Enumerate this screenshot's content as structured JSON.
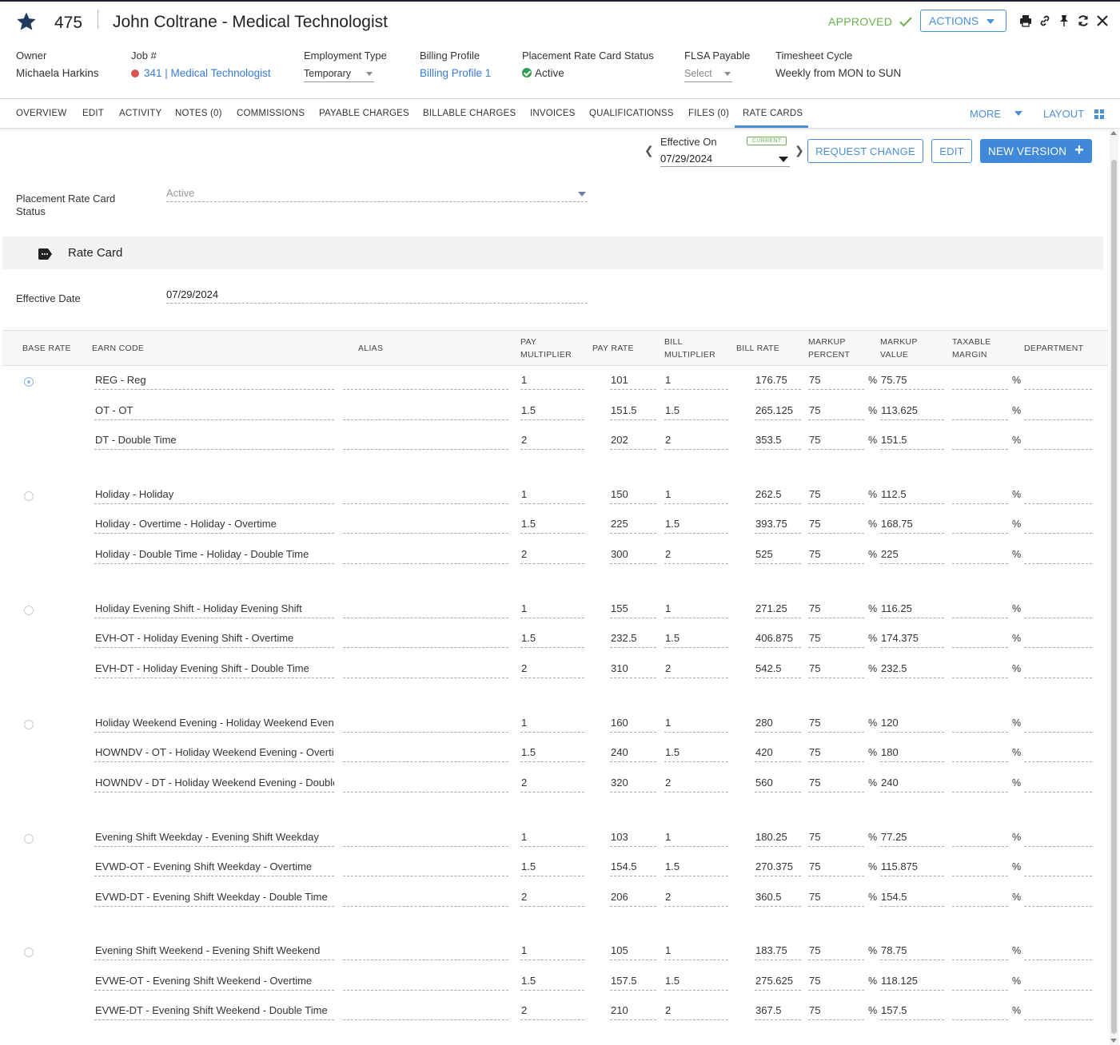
{
  "header": {
    "record_id": "475",
    "title": "John Coltrane - Medical Technologist",
    "status": "APPROVED",
    "actions_label": "ACTIONS",
    "fields": {
      "owner": {
        "label": "Owner",
        "value": "Michaela Harkins"
      },
      "job": {
        "label": "Job #",
        "value": "341 | Medical Technologist"
      },
      "employment_type": {
        "label": "Employment Type",
        "value": "Temporary"
      },
      "billing_profile": {
        "label": "Billing Profile",
        "value": "Billing Profile 1"
      },
      "rate_card_status": {
        "label": "Placement Rate Card Status",
        "value": "Active"
      },
      "flsa_payable": {
        "label": "FLSA Payable",
        "value": "Select"
      },
      "timesheet_cycle": {
        "label": "Timesheet Cycle",
        "value": "Weekly from MON to SUN"
      }
    }
  },
  "tabs": {
    "items": [
      "OVERVIEW",
      "EDIT",
      "ACTIVITY",
      "NOTES (0)",
      "COMMISSIONS",
      "PAYABLE CHARGES",
      "BILLABLE CHARGES",
      "INVOICES",
      "QUALIFICATIONSS",
      "FILES (0)",
      "RATE CARDS"
    ],
    "active": "RATE CARDS",
    "more_label": "MORE",
    "layout_label": "LAYOUT"
  },
  "toolbar": {
    "effective_on_label": "Effective On",
    "current_badge": "CURRENT",
    "effective_on_value": "07/29/2024",
    "request_change_label": "REQUEST CHANGE",
    "edit_label": "EDIT",
    "new_version_label": "NEW VERSION"
  },
  "form": {
    "status_label": "Placement Rate Card Status",
    "status_value": "Active",
    "section_title": "Rate Card",
    "effective_date_label": "Effective Date",
    "effective_date_value": "07/29/2024"
  },
  "table": {
    "headers": {
      "base_rate": "BASE RATE",
      "earn_code": "EARN CODE",
      "alias": "ALIAS",
      "pay_multiplier": "PAY MULTIPLIER",
      "pay_rate": "PAY RATE",
      "bill_multiplier": "BILL MULTIPLIER",
      "bill_rate": "BILL RATE",
      "markup_percent": "MARKUP PERCENT",
      "markup_value": "MARKUP VALUE",
      "taxable_margin": "TAXABLE MARGIN",
      "department": "DEPARTMENT"
    },
    "percent_symbol": "%",
    "groups": [
      {
        "base_rate_selected": true,
        "rows": [
          {
            "earn_code": "REG - Reg",
            "alias": "",
            "pay_multiplier": "1",
            "pay_rate": "101",
            "bill_multiplier": "1",
            "bill_rate": "176.75",
            "markup_percent": "75",
            "markup_value": "75.75",
            "taxable_margin": "",
            "department": ""
          },
          {
            "earn_code": "OT - OT",
            "alias": "",
            "pay_multiplier": "1.5",
            "pay_rate": "151.5",
            "bill_multiplier": "1.5",
            "bill_rate": "265.125",
            "markup_percent": "75",
            "markup_value": "113.625",
            "taxable_margin": "",
            "department": ""
          },
          {
            "earn_code": "DT - Double Time",
            "alias": "",
            "pay_multiplier": "2",
            "pay_rate": "202",
            "bill_multiplier": "2",
            "bill_rate": "353.5",
            "markup_percent": "75",
            "markup_value": "151.5",
            "taxable_margin": "",
            "department": ""
          }
        ]
      },
      {
        "base_rate_selected": false,
        "rows": [
          {
            "earn_code": "Holiday - Holiday",
            "alias": "",
            "pay_multiplier": "1",
            "pay_rate": "150",
            "bill_multiplier": "1",
            "bill_rate": "262.5",
            "markup_percent": "75",
            "markup_value": "112.5",
            "taxable_margin": "",
            "department": ""
          },
          {
            "earn_code": "Holiday - Overtime - Holiday - Overtime",
            "alias": "",
            "pay_multiplier": "1.5",
            "pay_rate": "225",
            "bill_multiplier": "1.5",
            "bill_rate": "393.75",
            "markup_percent": "75",
            "markup_value": "168.75",
            "taxable_margin": "",
            "department": ""
          },
          {
            "earn_code": "Holiday - Double Time - Holiday - Double Time",
            "alias": "",
            "pay_multiplier": "2",
            "pay_rate": "300",
            "bill_multiplier": "2",
            "bill_rate": "525",
            "markup_percent": "75",
            "markup_value": "225",
            "taxable_margin": "",
            "department": ""
          }
        ]
      },
      {
        "base_rate_selected": false,
        "rows": [
          {
            "earn_code": "Holiday Evening Shift - Holiday Evening Shift",
            "alias": "",
            "pay_multiplier": "1",
            "pay_rate": "155",
            "bill_multiplier": "1",
            "bill_rate": "271.25",
            "markup_percent": "75",
            "markup_value": "116.25",
            "taxable_margin": "",
            "department": ""
          },
          {
            "earn_code": "EVH-OT - Holiday Evening Shift - Overtime",
            "alias": "",
            "pay_multiplier": "1.5",
            "pay_rate": "232.5",
            "bill_multiplier": "1.5",
            "bill_rate": "406.875",
            "markup_percent": "75",
            "markup_value": "174.375",
            "taxable_margin": "",
            "department": ""
          },
          {
            "earn_code": "EVH-DT - Holiday Evening Shift - Double Time",
            "alias": "",
            "pay_multiplier": "2",
            "pay_rate": "310",
            "bill_multiplier": "2",
            "bill_rate": "542.5",
            "markup_percent": "75",
            "markup_value": "232.5",
            "taxable_margin": "",
            "department": ""
          }
        ]
      },
      {
        "base_rate_selected": false,
        "rows": [
          {
            "earn_code": "Holiday Weekend Evening  - Holiday Weekend Evening",
            "alias": "",
            "pay_multiplier": "1",
            "pay_rate": "160",
            "bill_multiplier": "1",
            "bill_rate": "280",
            "markup_percent": "75",
            "markup_value": "120",
            "taxable_margin": "",
            "department": ""
          },
          {
            "earn_code": "HOWNDV - OT - Holiday Weekend Evening - Overtime",
            "alias": "",
            "pay_multiplier": "1.5",
            "pay_rate": "240",
            "bill_multiplier": "1.5",
            "bill_rate": "420",
            "markup_percent": "75",
            "markup_value": "180",
            "taxable_margin": "",
            "department": ""
          },
          {
            "earn_code": "HOWNDV - DT - Holiday Weekend Evening - Double Time",
            "alias": "",
            "pay_multiplier": "2",
            "pay_rate": "320",
            "bill_multiplier": "2",
            "bill_rate": "560",
            "markup_percent": "75",
            "markup_value": "240",
            "taxable_margin": "",
            "department": ""
          }
        ]
      },
      {
        "base_rate_selected": false,
        "rows": [
          {
            "earn_code": "Evening Shift Weekday - Evening Shift Weekday",
            "alias": "",
            "pay_multiplier": "1",
            "pay_rate": "103",
            "bill_multiplier": "1",
            "bill_rate": "180.25",
            "markup_percent": "75",
            "markup_value": "77.25",
            "taxable_margin": "",
            "department": ""
          },
          {
            "earn_code": "EVWD-OT - Evening Shift Weekday - Overtime",
            "alias": "",
            "pay_multiplier": "1.5",
            "pay_rate": "154.5",
            "bill_multiplier": "1.5",
            "bill_rate": "270.375",
            "markup_percent": "75",
            "markup_value": "115.875",
            "taxable_margin": "",
            "department": ""
          },
          {
            "earn_code": "EVWD-DT - Evening Shift Weekday - Double Time",
            "alias": "",
            "pay_multiplier": "2",
            "pay_rate": "206",
            "bill_multiplier": "2",
            "bill_rate": "360.5",
            "markup_percent": "75",
            "markup_value": "154.5",
            "taxable_margin": "",
            "department": ""
          }
        ]
      },
      {
        "base_rate_selected": false,
        "rows": [
          {
            "earn_code": "Evening Shift Weekend - Evening Shift Weekend",
            "alias": "",
            "pay_multiplier": "1",
            "pay_rate": "105",
            "bill_multiplier": "1",
            "bill_rate": "183.75",
            "markup_percent": "75",
            "markup_value": "78.75",
            "taxable_margin": "",
            "department": ""
          },
          {
            "earn_code": "EVWE-OT - Evening Shift Weekend - Overtime",
            "alias": "",
            "pay_multiplier": "1.5",
            "pay_rate": "157.5",
            "bill_multiplier": "1.5",
            "bill_rate": "275.625",
            "markup_percent": "75",
            "markup_value": "118.125",
            "taxable_margin": "",
            "department": ""
          },
          {
            "earn_code": "EVWE-DT - Evening Shift Weekend - Double Time",
            "alias": "",
            "pay_multiplier": "2",
            "pay_rate": "210",
            "bill_multiplier": "2",
            "bill_rate": "367.5",
            "markup_percent": "75",
            "markup_value": "157.5",
            "taxable_margin": "",
            "department": ""
          }
        ]
      }
    ]
  },
  "colors": {
    "accent": "#4a90d9",
    "approved": "#6ab04c",
    "active_check": "#2e9e4f",
    "job_dot": "#d9534f",
    "star": "#1f3a5f"
  },
  "icons": [
    "star-icon",
    "check-icon",
    "chevron-down-icon",
    "print-icon",
    "link-icon",
    "pin-icon",
    "refresh-icon",
    "close-icon",
    "grid-icon",
    "chevron-left-icon",
    "chevron-right-icon",
    "plus-icon",
    "tag-icon"
  ]
}
